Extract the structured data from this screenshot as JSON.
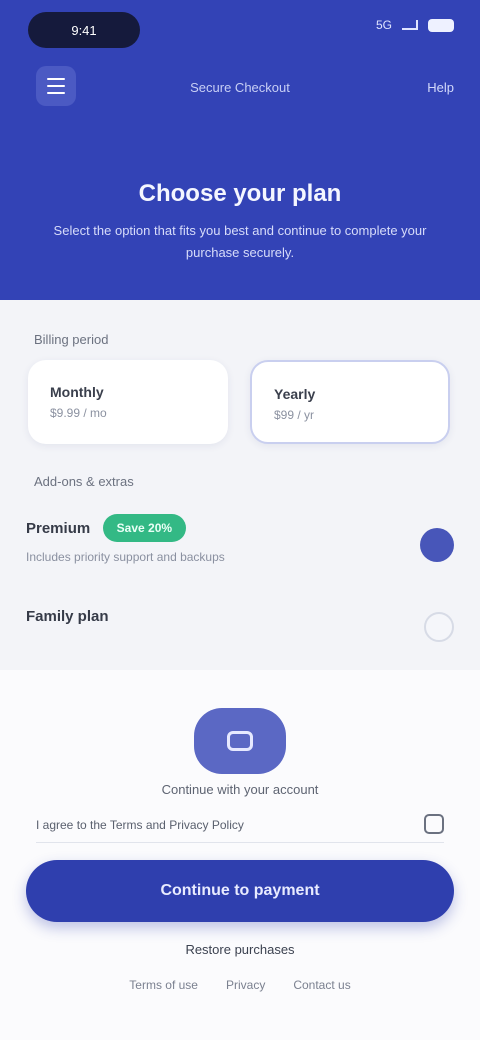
{
  "status_bar": {
    "time": "9:41",
    "network": "5G"
  },
  "header": {
    "title": "Secure Checkout",
    "link": "Help"
  },
  "hero": {
    "title": "Choose your plan",
    "subtitle": "Select the option that fits you best and continue to complete your purchase securely."
  },
  "billing": {
    "label": "Billing period",
    "options": [
      {
        "title": "Monthly",
        "sub": "$9.99 / mo"
      },
      {
        "title": "Yearly",
        "sub": "$99 / yr"
      }
    ]
  },
  "addons": {
    "label": "Add-ons & extras",
    "items": [
      {
        "title": "Premium",
        "badge": "Save 20%",
        "sub": "Includes priority support and backups",
        "enabled": true
      },
      {
        "title": "Family plan",
        "enabled": false
      }
    ]
  },
  "account": {
    "caption": "Continue with your account"
  },
  "consent": {
    "text": "I agree to the Terms and Privacy Policy"
  },
  "cta": {
    "label": "Continue to payment"
  },
  "secondary": {
    "label": "Restore purchases"
  },
  "footer": {
    "links": [
      "Terms of use",
      "Privacy",
      "Contact us"
    ]
  },
  "colors": {
    "primary": "#3343b6",
    "accent_green": "#33b985",
    "background": "#f3f4f8"
  },
  "icons": {
    "menu": "menu-icon",
    "avatar": "account-icon"
  }
}
